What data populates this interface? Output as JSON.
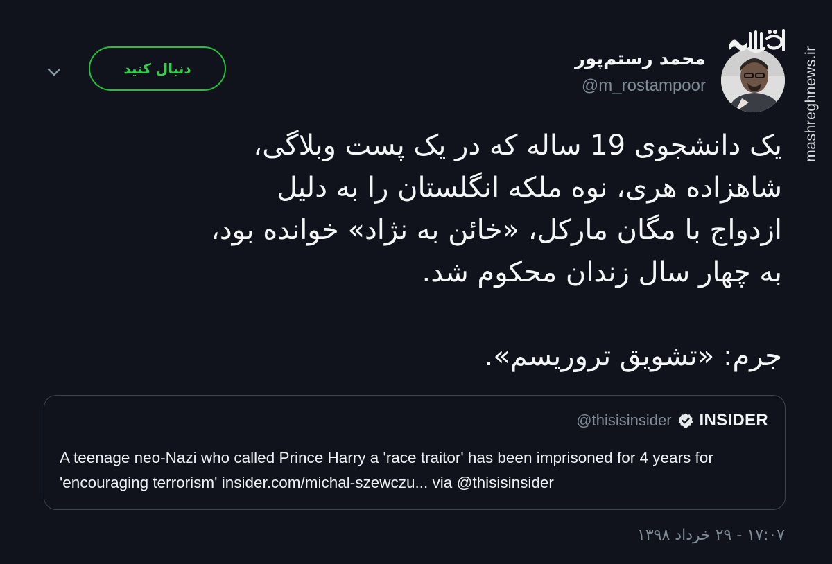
{
  "header": {
    "follow_label": "دنبال کنید",
    "author_name": "محمد رستم‌پور",
    "author_handle": "@m_rostampoor",
    "watermark": "mashreghnews.ir",
    "logo_text": "مشرق"
  },
  "tweet": {
    "lines": [
      "یک دانشجوی 19 ساله که در یک پست وبلاگی،",
      "شاهزاده هری، نوه ملکه انگلستان را به دلیل",
      "ازدواج با مگان مارکل، «خائن به نژاد» خوانده بود،",
      "به چهار سال زندان محکوم شد."
    ],
    "crime_line": "جرم: «تشویق تروریسم».",
    "timestamp": "۱۷:۰۷ - ۲۹ خرداد ۱۳۹۸"
  },
  "quote": {
    "name": "INSIDER",
    "handle": "@thisisinsider",
    "text": "A teenage neo-Nazi who called Prince Harry a 'race traitor' has been imprisoned for 4 years for 'encouraging terrorism' insider.com/michal-szewczu... via @thisisinsider"
  },
  "colors": {
    "background": "#10131b",
    "follow_green": "#22c23a",
    "secondary_text": "#7f8b96",
    "card_border": "#3a4350"
  },
  "icons": {
    "menu": "chevron-down-icon",
    "verified": "verified-badge-icon"
  }
}
